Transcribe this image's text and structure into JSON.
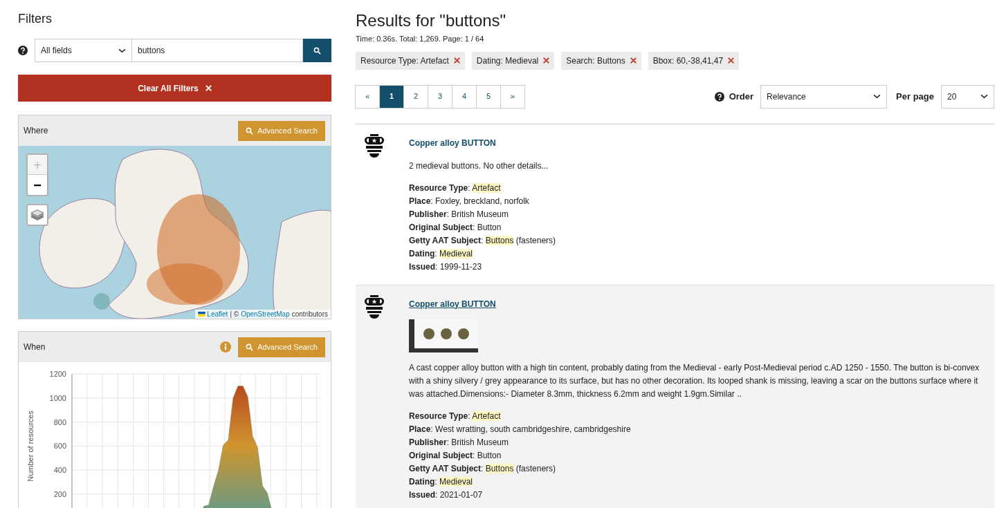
{
  "filters": {
    "title": "Filters",
    "search": {
      "field": "All fields",
      "value": "buttons"
    },
    "clear_button": "Clear All Filters",
    "where": {
      "title": "Where",
      "advanced_button": "Advanced Search",
      "zoom_in": "+",
      "zoom_out": "−",
      "attribution": {
        "link_1": "Leaflet",
        "separator": "| ©",
        "link_2": "OpenStreetMap",
        "suffix": "contributors"
      }
    },
    "when": {
      "title": "When",
      "advanced_button": "Advanced Search",
      "chart_data": {
        "type": "area",
        "grid": true,
        "ylabel": "Number of resources",
        "ylim": [
          0,
          1200
        ],
        "yticks": [
          200,
          400,
          600,
          800,
          1000,
          1200
        ],
        "values": [
          0,
          0,
          0,
          0,
          0,
          0,
          0,
          0,
          0,
          0,
          0,
          0,
          0,
          0,
          0,
          0,
          0,
          0,
          0,
          0,
          0,
          0,
          0,
          0,
          0,
          0,
          0,
          100,
          110,
          265,
          400,
          610,
          650,
          1000,
          1100,
          1100,
          1010,
          680,
          590,
          270,
          210,
          50,
          40,
          0,
          0,
          0,
          0,
          0,
          0,
          0,
          0,
          0
        ]
      }
    }
  },
  "results": {
    "title": "Results for \"buttons\"",
    "stats": "Time: 0.36s. Total: 1,269. Page: 1 / 64",
    "active_filters": [
      "Resource Type: Artefact",
      "Dating: Medieval",
      "Search: Buttons",
      "Bbox: 60,-38,41,47"
    ],
    "pagination": [
      {
        "label": "«",
        "selected": false
      },
      {
        "label": "1",
        "selected": true
      },
      {
        "label": "2",
        "selected": false
      },
      {
        "label": "3",
        "selected": false
      },
      {
        "label": "4",
        "selected": false
      },
      {
        "label": "5",
        "selected": false
      },
      {
        "label": "»",
        "selected": false
      }
    ],
    "order": {
      "label": "Order",
      "value": "Relevance"
    },
    "per_page": {
      "label": "Per page",
      "value": "20"
    },
    "items": [
      {
        "title": "Copper alloy BUTTON",
        "hovered": false,
        "has_image": false,
        "description": "2 medieval buttons. No other details...",
        "fields": [
          {
            "label": "Resource Type",
            "parts": [
              {
                "text": ": ",
                "highlighted": false
              },
              {
                "text": "Artefact",
                "highlighted": true
              }
            ]
          },
          {
            "label": "Place",
            "parts": [
              {
                "text": ": Foxley, breckland, norfolk",
                "highlighted": false
              }
            ]
          },
          {
            "label": "Publisher",
            "parts": [
              {
                "text": ": British Museum",
                "highlighted": false
              }
            ]
          },
          {
            "label": "Original Subject",
            "parts": [
              {
                "text": ": Button",
                "highlighted": false
              }
            ]
          },
          {
            "label": "Getty AAT Subject",
            "parts": [
              {
                "text": ": ",
                "highlighted": false
              },
              {
                "text": "Buttons",
                "highlighted": true
              },
              {
                "text": " (fasteners)",
                "highlighted": false
              }
            ]
          },
          {
            "label": "Dating",
            "parts": [
              {
                "text": ": ",
                "highlighted": false
              },
              {
                "text": "Medieval",
                "highlighted": true
              }
            ]
          },
          {
            "label": "Issued",
            "parts": [
              {
                "text": ": 1999-11-23",
                "highlighted": false
              }
            ]
          }
        ]
      },
      {
        "title": "Copper alloy BUTTON",
        "hovered": true,
        "has_image": true,
        "description": "A cast copper alloy button with a high tin content, probably dating from the Medieval - early Post-Medieval period c.AD 1250 - 1550. The button is bi-convex with a shiny silvery / grey appearance to its surface, but has no other decoration. Its looped shank is missing, leaving a scar on the buttons surface where it was attached.Dimensions:- Diameter 8.3mm, thickness 6.2mm and weight 1.9gm.Similar ..",
        "fields": [
          {
            "label": "Resource Type",
            "parts": [
              {
                "text": ": ",
                "highlighted": false
              },
              {
                "text": "Artefact",
                "highlighted": true
              }
            ]
          },
          {
            "label": "Place",
            "parts": [
              {
                "text": ": West wratting, south cambridgeshire, cambridgeshire",
                "highlighted": false
              }
            ]
          },
          {
            "label": "Publisher",
            "parts": [
              {
                "text": ": British Museum",
                "highlighted": false
              }
            ]
          },
          {
            "label": "Original Subject",
            "parts": [
              {
                "text": ": Button",
                "highlighted": false
              }
            ]
          },
          {
            "label": "Getty AAT Subject",
            "parts": [
              {
                "text": ": ",
                "highlighted": false
              },
              {
                "text": "Buttons",
                "highlighted": true
              },
              {
                "text": " (fasteners)",
                "highlighted": false
              }
            ]
          },
          {
            "label": "Dating",
            "parts": [
              {
                "text": ": ",
                "highlighted": false
              },
              {
                "text": "Medieval",
                "highlighted": true
              }
            ]
          },
          {
            "label": "Issued",
            "parts": [
              {
                "text": ": 2021-01-07",
                "highlighted": false
              }
            ]
          }
        ]
      }
    ]
  }
}
